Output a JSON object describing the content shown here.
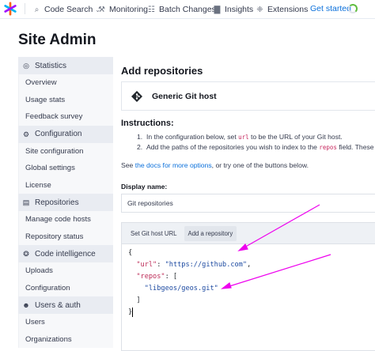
{
  "nav": {
    "items": [
      {
        "label": "Code Search",
        "icon": "search-icon"
      },
      {
        "label": "Monitoring",
        "icon": "monitoring-icon"
      },
      {
        "label": "Batch Changes",
        "icon": "batch-changes-icon"
      },
      {
        "label": "Insights",
        "icon": "insights-icon"
      },
      {
        "label": "Extensions",
        "icon": "extensions-icon"
      }
    ],
    "get_started": "Get started"
  },
  "page_title": "Site Admin",
  "sidebar": {
    "groups": [
      {
        "title": "Statistics",
        "icon": "globe-icon",
        "links": [
          "Overview",
          "Usage stats",
          "Feedback survey"
        ]
      },
      {
        "title": "Configuration",
        "icon": "cog-icon",
        "links": [
          "Site configuration",
          "Global settings",
          "License"
        ]
      },
      {
        "title": "Repositories",
        "icon": "repo-icon",
        "links": [
          "Manage code hosts",
          "Repository status"
        ]
      },
      {
        "title": "Code intelligence",
        "icon": "brain-icon",
        "links": [
          "Uploads",
          "Configuration"
        ]
      },
      {
        "title": "Users & auth",
        "icon": "users-icon",
        "links": [
          "Users",
          "Organizations"
        ]
      }
    ]
  },
  "main": {
    "heading": "Add repositories",
    "host_name": "Generic Git host",
    "instructions_title": "Instructions:",
    "instr1_a": "In the configuration below, set ",
    "instr1_code": "url",
    "instr1_b": " to be the URL of your Git host.",
    "instr2_a": "Add the paths of the repositories you wish to index to the ",
    "instr2_code": "repos",
    "instr2_b": " field. These",
    "docs_a": "See ",
    "docs_link": "the docs for more options",
    "docs_b": ", or try one of the buttons below.",
    "display_label": "Display name:",
    "display_value": "Git repositories",
    "buttons": [
      "Set Git host URL",
      "Add a repository"
    ],
    "code": {
      "open": "{",
      "url_key": "\"url\"",
      "url_value": "\"https://github.com\"",
      "repos_key": "\"repos\"",
      "repo_value": "\"libgeos/geos.git\"",
      "close_bracket": "]",
      "close": "}"
    }
  },
  "colors": {
    "arrow": "#ee00ee",
    "link": "#0b70db"
  }
}
